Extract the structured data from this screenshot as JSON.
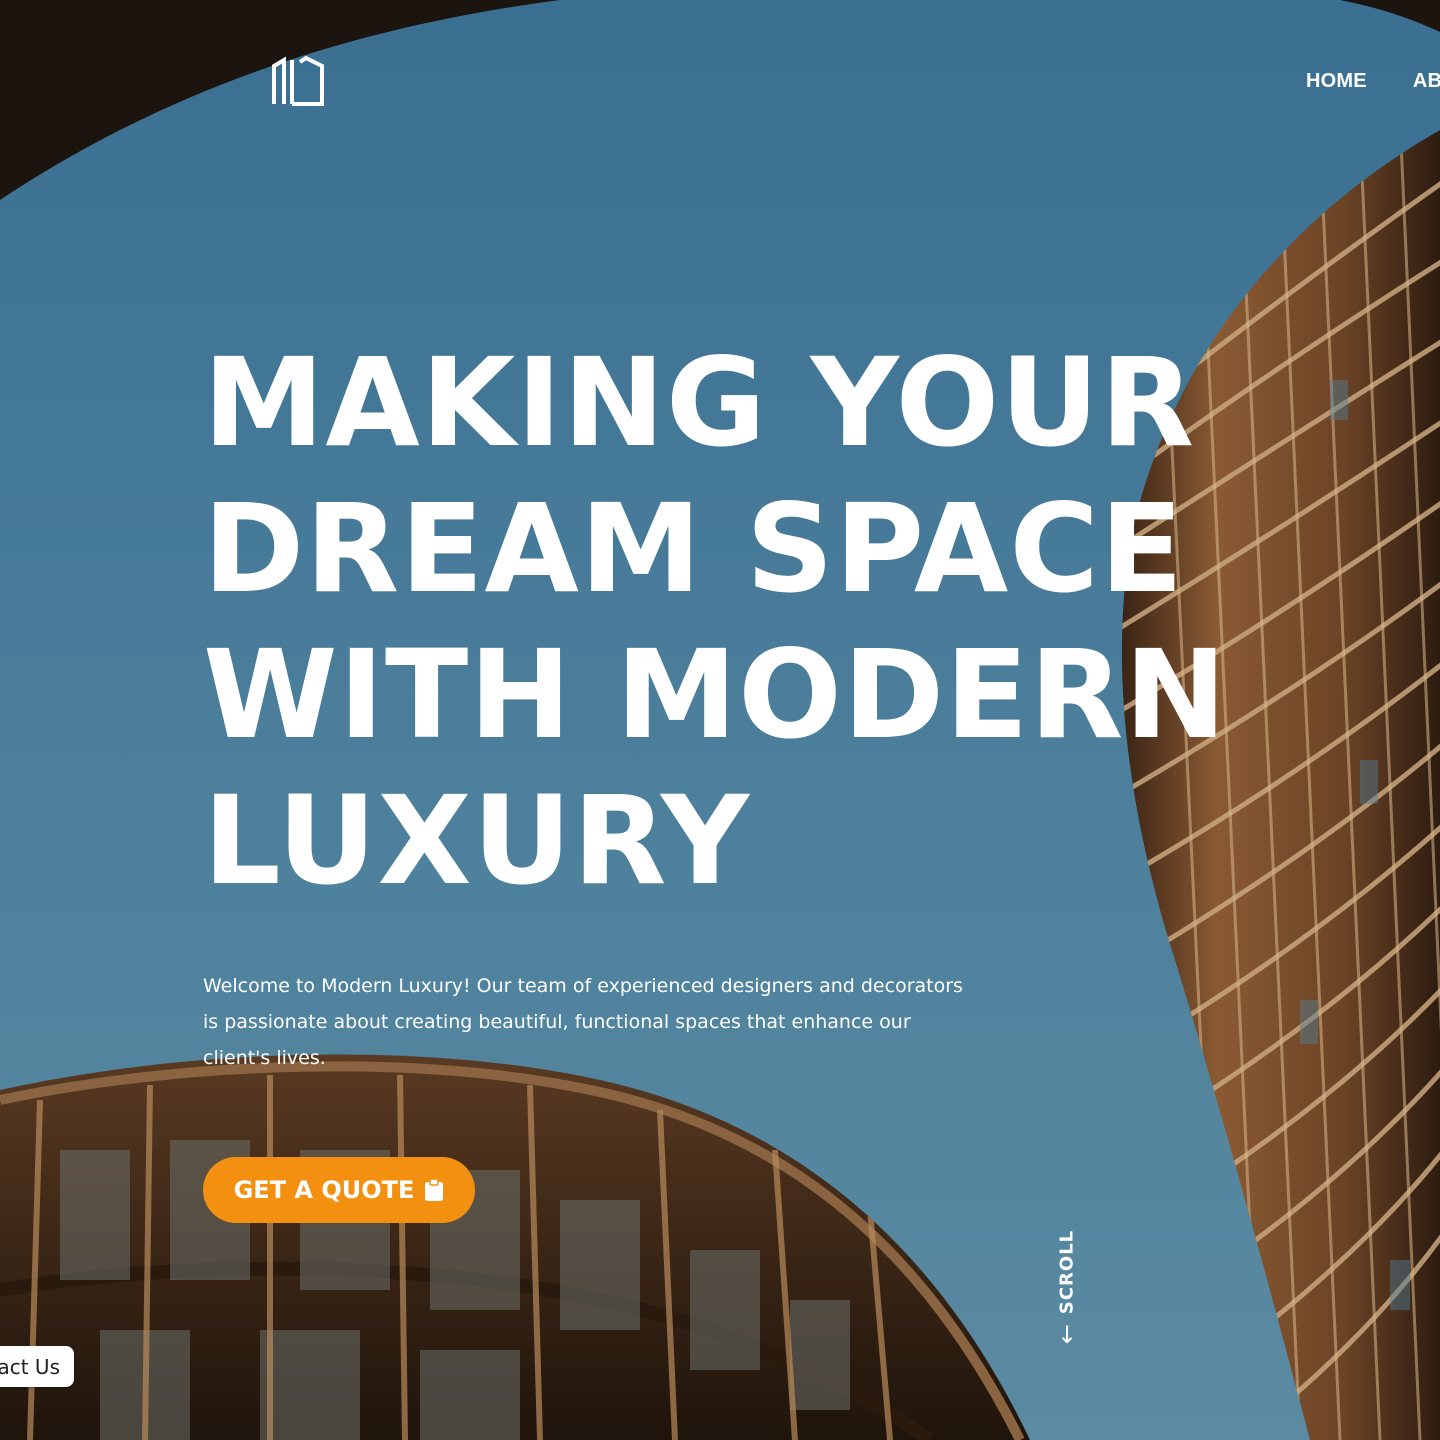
{
  "brand": {
    "logo_icon": "building-monogram-icon"
  },
  "nav": {
    "items": [
      {
        "label": "HOME"
      },
      {
        "label": "AB"
      }
    ]
  },
  "hero": {
    "headline_lines": [
      "MAKING YOUR",
      "DREAM SPACE",
      "WITH MODERN",
      "LUXURY"
    ],
    "intro": "Welcome to Modern Luxury! Our team of experienced designers and decorators is passionate about creating beautiful, functional spaces that enhance our client's lives.",
    "cta": {
      "label": "GET A QUOTE",
      "icon": "clipboard-icon",
      "color": "#f3900f"
    }
  },
  "scroll": {
    "label": "SCROLL",
    "arrow": "↓"
  },
  "contact_tab": {
    "label": "act Us"
  },
  "colors": {
    "sky": "#4a7d9a",
    "accent": "#f3900f",
    "text": "#ffffff"
  }
}
